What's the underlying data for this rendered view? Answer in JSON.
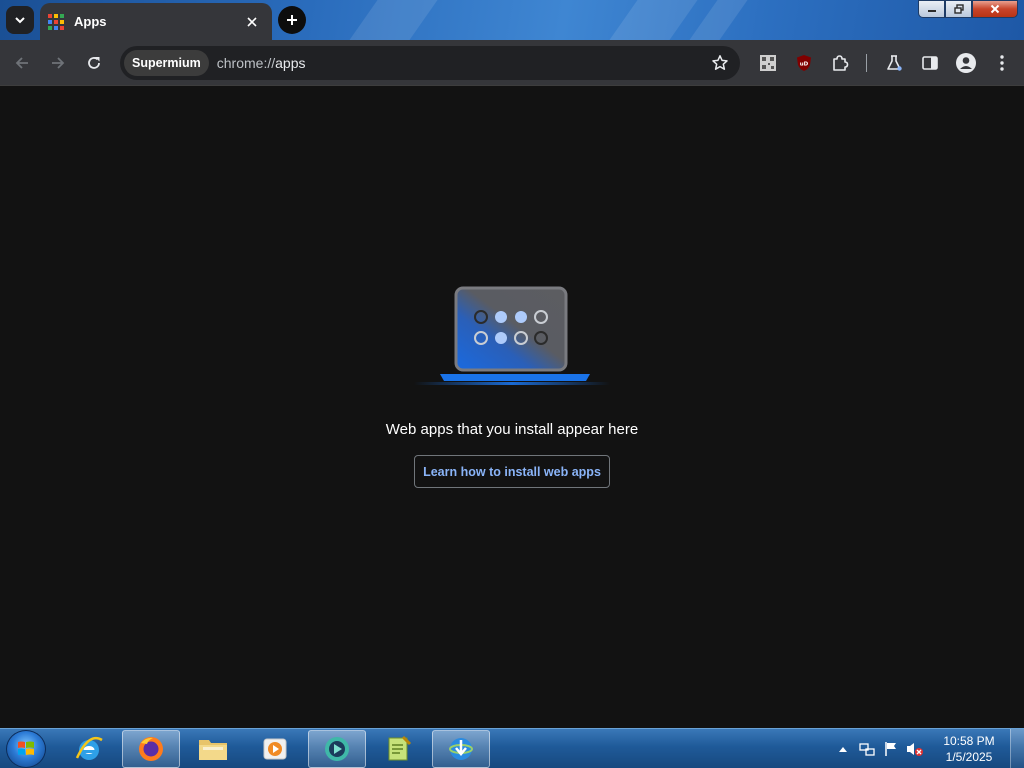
{
  "browser": {
    "tab": {
      "title": "Apps"
    },
    "omnibox": {
      "chip_label": "Supermium",
      "url_scheme": "chrome://",
      "url_host": "apps"
    }
  },
  "page": {
    "empty_message": "Web apps that you install appear here",
    "learn_button_label": "Learn how to install web apps"
  },
  "taskbar": {
    "apps": [
      "internet-explorer",
      "firefox",
      "file-explorer",
      "media-player",
      "supermium-browser",
      "notepad-plus",
      "internet-download-manager"
    ],
    "clock": {
      "time": "10:58 PM",
      "date": "1/5/2025"
    }
  },
  "colors": {
    "page_background": "#121212",
    "toolbar_background": "#35363a",
    "link_accent": "#8ab4f8",
    "illustration_blue": "#1a73e8"
  }
}
